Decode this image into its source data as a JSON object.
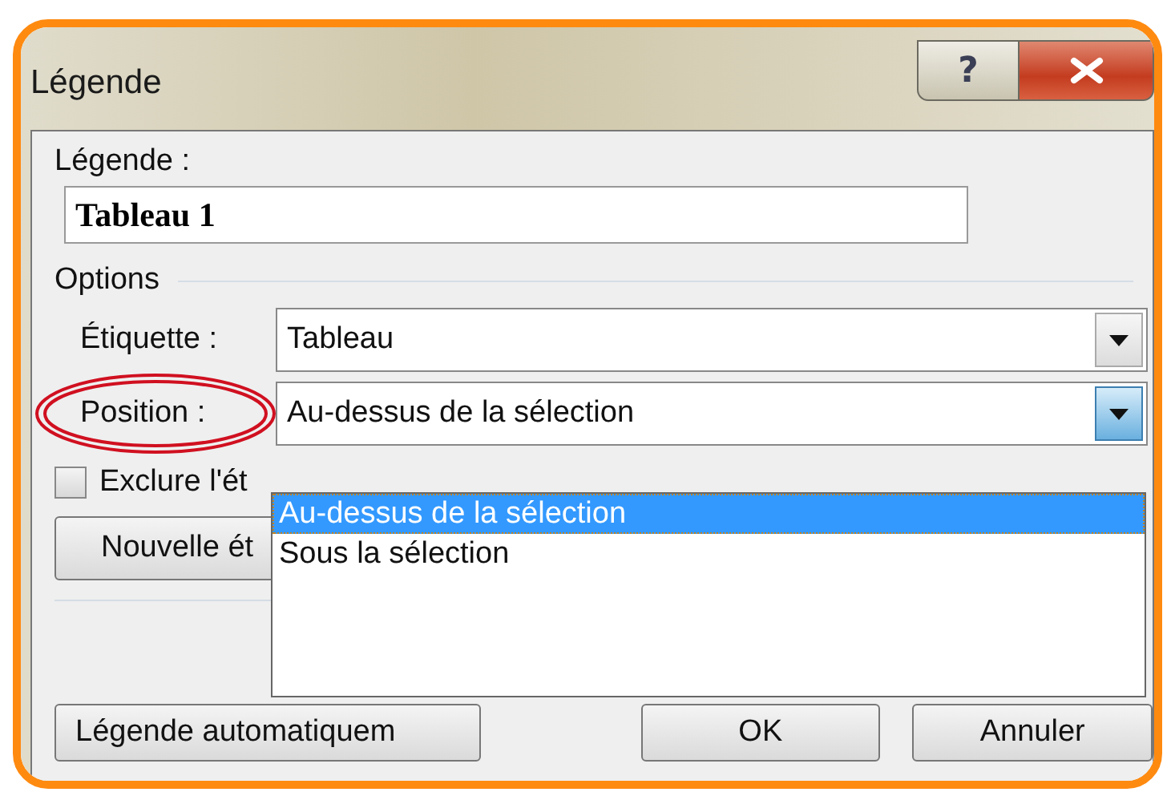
{
  "window": {
    "title": "Légende",
    "help_button": "?"
  },
  "caption": {
    "label": "Légende :",
    "value": "Tableau 1"
  },
  "options": {
    "heading": "Options",
    "label_field": {
      "label": "Étiquette :",
      "value": "Tableau"
    },
    "position_field": {
      "label": "Position :",
      "value": "Au-dessus de la sélection",
      "expanded": true,
      "highlighted": true,
      "options": [
        {
          "label": "Au-dessus de la sélection",
          "selected": true
        },
        {
          "label": "Sous la sélection",
          "selected": false
        }
      ]
    },
    "exclude": {
      "label": "Exclure l'ét",
      "checked": false
    },
    "new_label_button": "Nouvelle ét"
  },
  "buttons": [
    {
      "label": "Légende automatiquem",
      "kind": "wide"
    },
    {
      "label": "OK",
      "kind": "normal"
    },
    {
      "label": "Annuler",
      "kind": "normal"
    }
  ]
}
